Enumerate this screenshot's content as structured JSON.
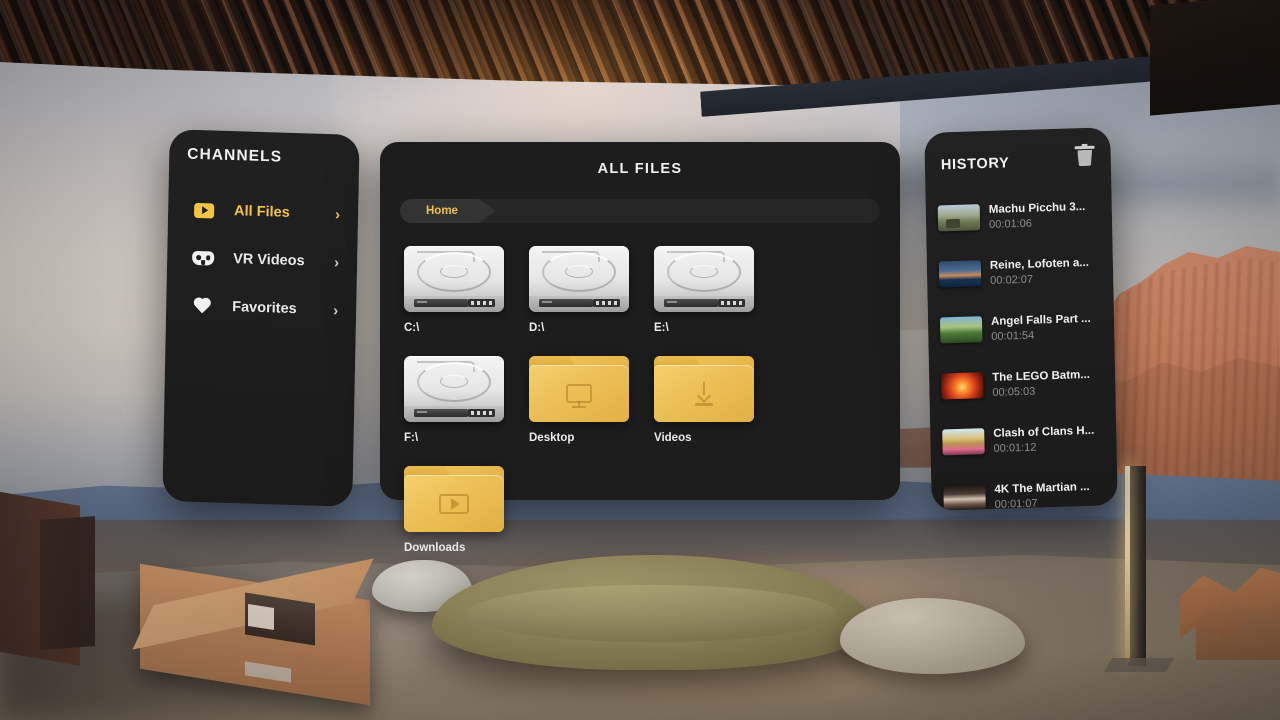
{
  "sidebar": {
    "title": "CHANNELS",
    "items": [
      {
        "label": "All Files",
        "icon": "play-box-icon",
        "active": true,
        "chevron": "›"
      },
      {
        "label": "VR Videos",
        "icon": "vr-goggles-icon",
        "active": false,
        "chevron": "›"
      },
      {
        "label": "Favorites",
        "icon": "heart-icon",
        "active": false,
        "chevron": "›"
      }
    ]
  },
  "main": {
    "title": "ALL FILES",
    "breadcrumb": [
      "Home"
    ],
    "drives": [
      {
        "label": "C:\\",
        "icon": "hard-drive-icon"
      },
      {
        "label": "D:\\",
        "icon": "hard-drive-icon"
      },
      {
        "label": "E:\\",
        "icon": "hard-drive-icon"
      },
      {
        "label": "F:\\",
        "icon": "hard-drive-icon"
      }
    ],
    "folders": [
      {
        "label": "Desktop",
        "icon": "monitor-icon"
      },
      {
        "label": "Videos",
        "icon": "download-icon"
      },
      {
        "label": "Downloads",
        "icon": "play-rect-icon"
      }
    ]
  },
  "history": {
    "title": "HISTORY",
    "clear_icon": "trash-icon",
    "items": [
      {
        "title": "Machu Picchu 3...",
        "time": "00:01:06"
      },
      {
        "title": "Reine, Lofoten a...",
        "time": "00:02:07"
      },
      {
        "title": "Angel Falls Part ...",
        "time": "00:01:54"
      },
      {
        "title": "The LEGO Batm...",
        "time": "00:05:03"
      },
      {
        "title": "Clash of Clans H...",
        "time": "00:01:12"
      },
      {
        "title": "4K The Martian ...",
        "time": "00:01:07"
      }
    ]
  },
  "colors": {
    "accent": "#f4c544",
    "panel": "#1d1d1d",
    "text": "#f0f0f0",
    "muted": "#8d8d8d"
  }
}
